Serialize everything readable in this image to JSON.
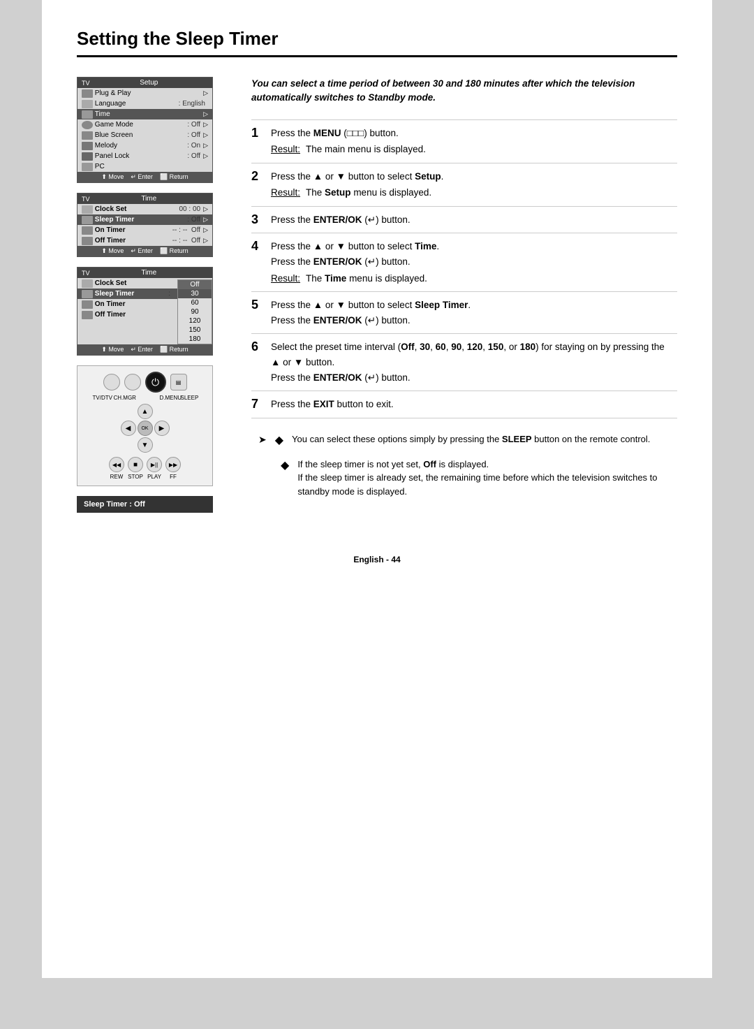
{
  "page": {
    "title": "Setting the Sleep Timer",
    "footer": "English - 44"
  },
  "intro": {
    "text": "You can select a time period of between 30 and 180 minutes after which the television automatically switches to Standby mode."
  },
  "panel1": {
    "header_tv": "TV",
    "header_title": "Setup",
    "rows": [
      {
        "label": "Plug & Play",
        "value": "",
        "arrow": "▷",
        "highlighted": false
      },
      {
        "label": "Language",
        "value": ": English",
        "arrow": "",
        "highlighted": false
      },
      {
        "label": "Time",
        "value": "",
        "arrow": "▷",
        "highlighted": true
      },
      {
        "label": "Game Mode",
        "value": ": Off",
        "arrow": "▷",
        "highlighted": false
      },
      {
        "label": "Blue Screen",
        "value": ": Off",
        "arrow": "▷",
        "highlighted": false
      },
      {
        "label": "Melody",
        "value": ": On",
        "arrow": "▷",
        "highlighted": false
      },
      {
        "label": "Panel Lock",
        "value": ": Off",
        "arrow": "▷",
        "highlighted": false
      },
      {
        "label": "PC",
        "value": "",
        "arrow": "",
        "highlighted": false
      }
    ],
    "footer": "⬆ Move  ↵ Enter  ⬜ Return"
  },
  "panel2": {
    "header_tv": "TV",
    "header_title": "Time",
    "rows": [
      {
        "label": "Clock Set",
        "value": "00 : 00",
        "arrow": "▷",
        "highlighted": false
      },
      {
        "label": "Sleep Timer",
        "value": ": Off",
        "arrow": "▷",
        "highlighted": true
      },
      {
        "label": "On Timer",
        "value": "-- : --  Off",
        "arrow": "▷",
        "highlighted": false
      },
      {
        "label": "Off Timer",
        "value": "-- : --  Off",
        "arrow": "▷",
        "highlighted": false
      }
    ],
    "footer": "⬆ Move  ↵ Enter  ⬜ Return"
  },
  "panel3": {
    "header_tv": "TV",
    "header_title": "Time",
    "rows": [
      {
        "label": "Clock Set",
        "value": "",
        "highlighted": false
      },
      {
        "label": "Sleep Timer",
        "value": ":",
        "highlighted": false
      },
      {
        "label": "On Timer",
        "value": "",
        "highlighted": false
      },
      {
        "label": "Off Timer",
        "value": "",
        "highlighted": false
      }
    ],
    "dropdown": {
      "header": "Off",
      "items": [
        {
          "value": "Off",
          "selected": false
        },
        {
          "value": "30",
          "selected": true
        },
        {
          "value": "60",
          "selected": false
        },
        {
          "value": "90",
          "selected": false
        },
        {
          "value": "120",
          "selected": false
        },
        {
          "value": "150",
          "selected": false
        },
        {
          "value": "180",
          "selected": false
        }
      ]
    },
    "footer": "⬆ Move  ↵ Enter  ⬜ Return"
  },
  "remote": {
    "top_labels": [
      "TV/DTV",
      "CH.MGR",
      "D.MENU",
      "SLEEP"
    ],
    "transport_labels": [
      "REW",
      "STOP",
      "PLAY",
      "FF"
    ],
    "transport_symbols": [
      "◀◀",
      "■",
      "▶||",
      "▶▶"
    ]
  },
  "sleep_timer_box": {
    "label": "Sleep Timer",
    "value": ": Off"
  },
  "steps": [
    {
      "num": "1",
      "instruction": "Press the MENU (  ) button.",
      "result_label": "Result:",
      "result_text": "The main menu is displayed."
    },
    {
      "num": "2",
      "instruction": "Press the ▲ or ▼ button to select Setup.",
      "result_label": "Result:",
      "result_text": "The Setup menu is displayed."
    },
    {
      "num": "3",
      "instruction": "Press the ENTER/OK (  ) button.",
      "result_label": "",
      "result_text": ""
    },
    {
      "num": "4",
      "instruction": "Press the ▲ or ▼ button to select Time.",
      "instruction2": "Press the ENTER/OK (  ) button.",
      "result_label": "Result:",
      "result_text": "The Time menu is displayed."
    },
    {
      "num": "5",
      "instruction": "Press the ▲ or ▼ button to select Sleep Timer.",
      "instruction2": "Press the ENTER/OK (  ) button.",
      "result_label": "",
      "result_text": ""
    },
    {
      "num": "6",
      "instruction": "Select the preset time interval (Off, 30, 60, 90, 120, 150, or 180) for staying on by pressing the ▲ or ▼ button.",
      "instruction2": "Press the ENTER/OK (  ) button.",
      "result_label": "",
      "result_text": ""
    },
    {
      "num": "7",
      "instruction": "Press the EXIT button to exit.",
      "result_label": "",
      "result_text": ""
    }
  ],
  "notes": [
    {
      "type": "arrow",
      "text": "You can select these options simply by pressing the SLEEP button on the remote control."
    },
    {
      "type": "bullet",
      "text": "If the sleep timer is not yet set, Off is displayed. If the sleep timer is already set, the remaining time before which the television switches to standby mode is displayed."
    }
  ]
}
